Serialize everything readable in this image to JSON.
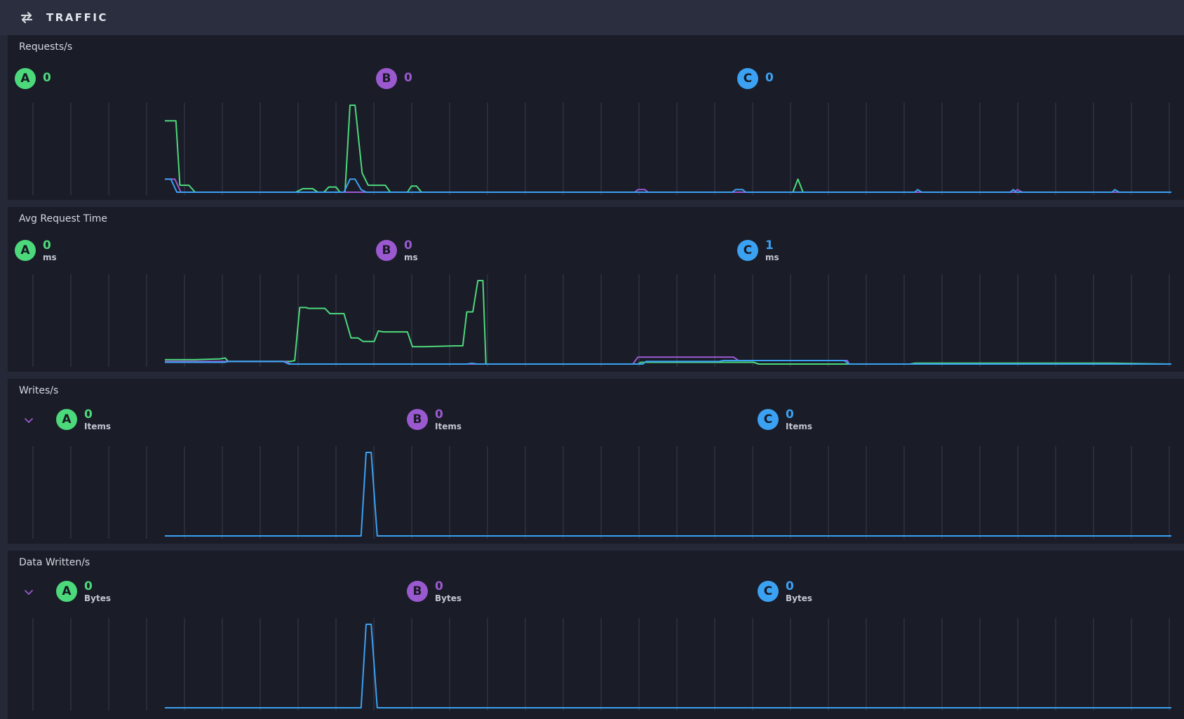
{
  "header": {
    "title": "TRAFFIC",
    "icon": "swap-arrows-icon"
  },
  "colors": {
    "A": "#4cd97b",
    "B": "#9b59d0",
    "C": "#3ba1f2",
    "grid": "#3a3d4e",
    "panel_bg": "#1a1c28",
    "page_bg": "#252837"
  },
  "panels": [
    {
      "title": "Requests/s",
      "metrics": [
        {
          "key": "A",
          "letter": "A",
          "value": "0",
          "unit": ""
        },
        {
          "key": "B",
          "letter": "B",
          "value": "0",
          "unit": ""
        },
        {
          "key": "C",
          "letter": "C",
          "value": "0",
          "unit": ""
        }
      ]
    },
    {
      "title": "Avg Request Time",
      "metrics": [
        {
          "key": "A",
          "letter": "A",
          "value": "0",
          "unit": "ms"
        },
        {
          "key": "B",
          "letter": "B",
          "value": "0",
          "unit": "ms"
        },
        {
          "key": "C",
          "letter": "C",
          "value": "1",
          "unit": "ms"
        }
      ]
    },
    {
      "title": "Writes/s",
      "collapse_icon": "chevron-down-icon",
      "metrics": [
        {
          "key": "A",
          "letter": "A",
          "value": "0",
          "unit": "Items"
        },
        {
          "key": "B",
          "letter": "B",
          "value": "0",
          "unit": "Items"
        },
        {
          "key": "C",
          "letter": "C",
          "value": "0",
          "unit": "Items"
        }
      ]
    },
    {
      "title": "Data Written/s",
      "collapse_icon": "chevron-down-icon",
      "metrics": [
        {
          "key": "A",
          "letter": "A",
          "value": "0",
          "unit": "Bytes"
        },
        {
          "key": "B",
          "letter": "B",
          "value": "0",
          "unit": "Bytes"
        },
        {
          "key": "C",
          "letter": "C",
          "value": "0",
          "unit": "Bytes"
        }
      ]
    }
  ],
  "chart_data": [
    {
      "type": "line",
      "ylim": [
        0,
        1
      ],
      "grid": true,
      "series": [
        {
          "key": "A",
          "points": [
            [
              0,
              0.82
            ],
            [
              0.011,
              0.82
            ],
            [
              0.015,
              0.08
            ],
            [
              0.024,
              0.08
            ],
            [
              0.03,
              0
            ],
            [
              0.13,
              0
            ],
            [
              0.137,
              0.04
            ],
            [
              0.147,
              0.04
            ],
            [
              0.152,
              0
            ],
            [
              0.158,
              0
            ],
            [
              0.163,
              0.06
            ],
            [
              0.17,
              0.06
            ],
            [
              0.174,
              0
            ],
            [
              0.179,
              0
            ],
            [
              0.184,
              1
            ],
            [
              0.189,
              1
            ],
            [
              0.196,
              0.22
            ],
            [
              0.202,
              0.08
            ],
            [
              0.219,
              0.08
            ],
            [
              0.224,
              0
            ],
            [
              0.241,
              0
            ],
            [
              0.245,
              0.07
            ],
            [
              0.25,
              0.07
            ],
            [
              0.255,
              0
            ],
            [
              0.624,
              0
            ],
            [
              0.629,
              0.15
            ],
            [
              0.634,
              0
            ],
            [
              1,
              0
            ]
          ]
        },
        {
          "key": "B",
          "points": [
            [
              0,
              0.15
            ],
            [
              0.01,
              0.15
            ],
            [
              0.016,
              0
            ],
            [
              0.467,
              0
            ],
            [
              0.47,
              0.03
            ],
            [
              0.477,
              0.03
            ],
            [
              0.48,
              0
            ],
            [
              0.844,
              0
            ],
            [
              0.847,
              0.03
            ],
            [
              0.852,
              0
            ],
            [
              1,
              0
            ]
          ]
        },
        {
          "key": "C",
          "points": [
            [
              0,
              0.15
            ],
            [
              0.006,
              0.15
            ],
            [
              0.012,
              0
            ],
            [
              0.178,
              0
            ],
            [
              0.184,
              0.15
            ],
            [
              0.189,
              0.15
            ],
            [
              0.195,
              0.03
            ],
            [
              0.2,
              0
            ],
            [
              0.564,
              0
            ],
            [
              0.567,
              0.03
            ],
            [
              0.574,
              0.03
            ],
            [
              0.577,
              0
            ],
            [
              0.745,
              0
            ],
            [
              0.748,
              0.03
            ],
            [
              0.752,
              0
            ],
            [
              0.84,
              0
            ],
            [
              0.843,
              0.03
            ],
            [
              0.846,
              0
            ],
            [
              0.941,
              0
            ],
            [
              0.944,
              0.03
            ],
            [
              0.948,
              0
            ],
            [
              1,
              0
            ]
          ]
        }
      ]
    },
    {
      "type": "line",
      "ylim": [
        0,
        1
      ],
      "grid": true,
      "series": [
        {
          "key": "A",
          "points": [
            [
              0,
              0.05
            ],
            [
              0.03,
              0.05
            ],
            [
              0.055,
              0.06
            ],
            [
              0.06,
              0.07
            ],
            [
              0.063,
              0.03
            ],
            [
              0.125,
              0.03
            ],
            [
              0.129,
              0.04
            ],
            [
              0.134,
              0.65
            ],
            [
              0.14,
              0.65
            ],
            [
              0.143,
              0.64
            ],
            [
              0.159,
              0.64
            ],
            [
              0.164,
              0.58
            ],
            [
              0.178,
              0.58
            ],
            [
              0.185,
              0.3
            ],
            [
              0.192,
              0.3
            ],
            [
              0.197,
              0.26
            ],
            [
              0.208,
              0.26
            ],
            [
              0.212,
              0.38
            ],
            [
              0.217,
              0.37
            ],
            [
              0.241,
              0.37
            ],
            [
              0.246,
              0.2
            ],
            [
              0.258,
              0.2
            ],
            [
              0.29,
              0.21
            ],
            [
              0.296,
              0.21
            ],
            [
              0.3,
              0.6
            ],
            [
              0.306,
              0.6
            ],
            [
              0.311,
              0.96
            ],
            [
              0.316,
              0.96
            ],
            [
              0.319,
              0
            ],
            [
              0.47,
              0
            ],
            [
              0.473,
              0.02
            ],
            [
              0.585,
              0.02
            ],
            [
              0.59,
              0
            ],
            [
              0.74,
              0
            ],
            [
              0.745,
              0.01
            ],
            [
              0.94,
              0.01
            ],
            [
              1,
              0
            ]
          ]
        },
        {
          "key": "B",
          "points": [
            [
              0,
              0.03
            ],
            [
              0.12,
              0.03
            ],
            [
              0.125,
              0
            ],
            [
              0.465,
              0
            ],
            [
              0.47,
              0.08
            ],
            [
              0.565,
              0.08
            ],
            [
              0.57,
              0.04
            ],
            [
              0.678,
              0.04
            ],
            [
              0.68,
              0
            ],
            [
              1,
              0
            ]
          ]
        },
        {
          "key": "C",
          "points": [
            [
              0,
              0.02
            ],
            [
              0.06,
              0.02
            ],
            [
              0.063,
              0.03
            ],
            [
              0.118,
              0.03
            ],
            [
              0.123,
              0
            ],
            [
              0.3,
              0
            ],
            [
              0.305,
              0.01
            ],
            [
              0.31,
              0
            ],
            [
              0.475,
              0
            ],
            [
              0.478,
              0.03
            ],
            [
              0.55,
              0.03
            ],
            [
              0.555,
              0.04
            ],
            [
              0.675,
              0.04
            ],
            [
              0.68,
              0
            ],
            [
              1,
              0
            ]
          ]
        }
      ]
    },
    {
      "type": "line",
      "ylim": [
        0,
        1
      ],
      "grid": true,
      "series": [
        {
          "key": "C",
          "points": [
            [
              0,
              0
            ],
            [
              0.195,
              0
            ],
            [
              0.2,
              0.96
            ],
            [
              0.205,
              0.96
            ],
            [
              0.211,
              0
            ],
            [
              1,
              0
            ]
          ]
        }
      ]
    },
    {
      "type": "line",
      "ylim": [
        0,
        1
      ],
      "grid": true,
      "series": [
        {
          "key": "C",
          "points": [
            [
              0,
              0
            ],
            [
              0.195,
              0
            ],
            [
              0.2,
              0.96
            ],
            [
              0.205,
              0.96
            ],
            [
              0.211,
              0
            ],
            [
              1,
              0
            ]
          ]
        }
      ]
    }
  ]
}
